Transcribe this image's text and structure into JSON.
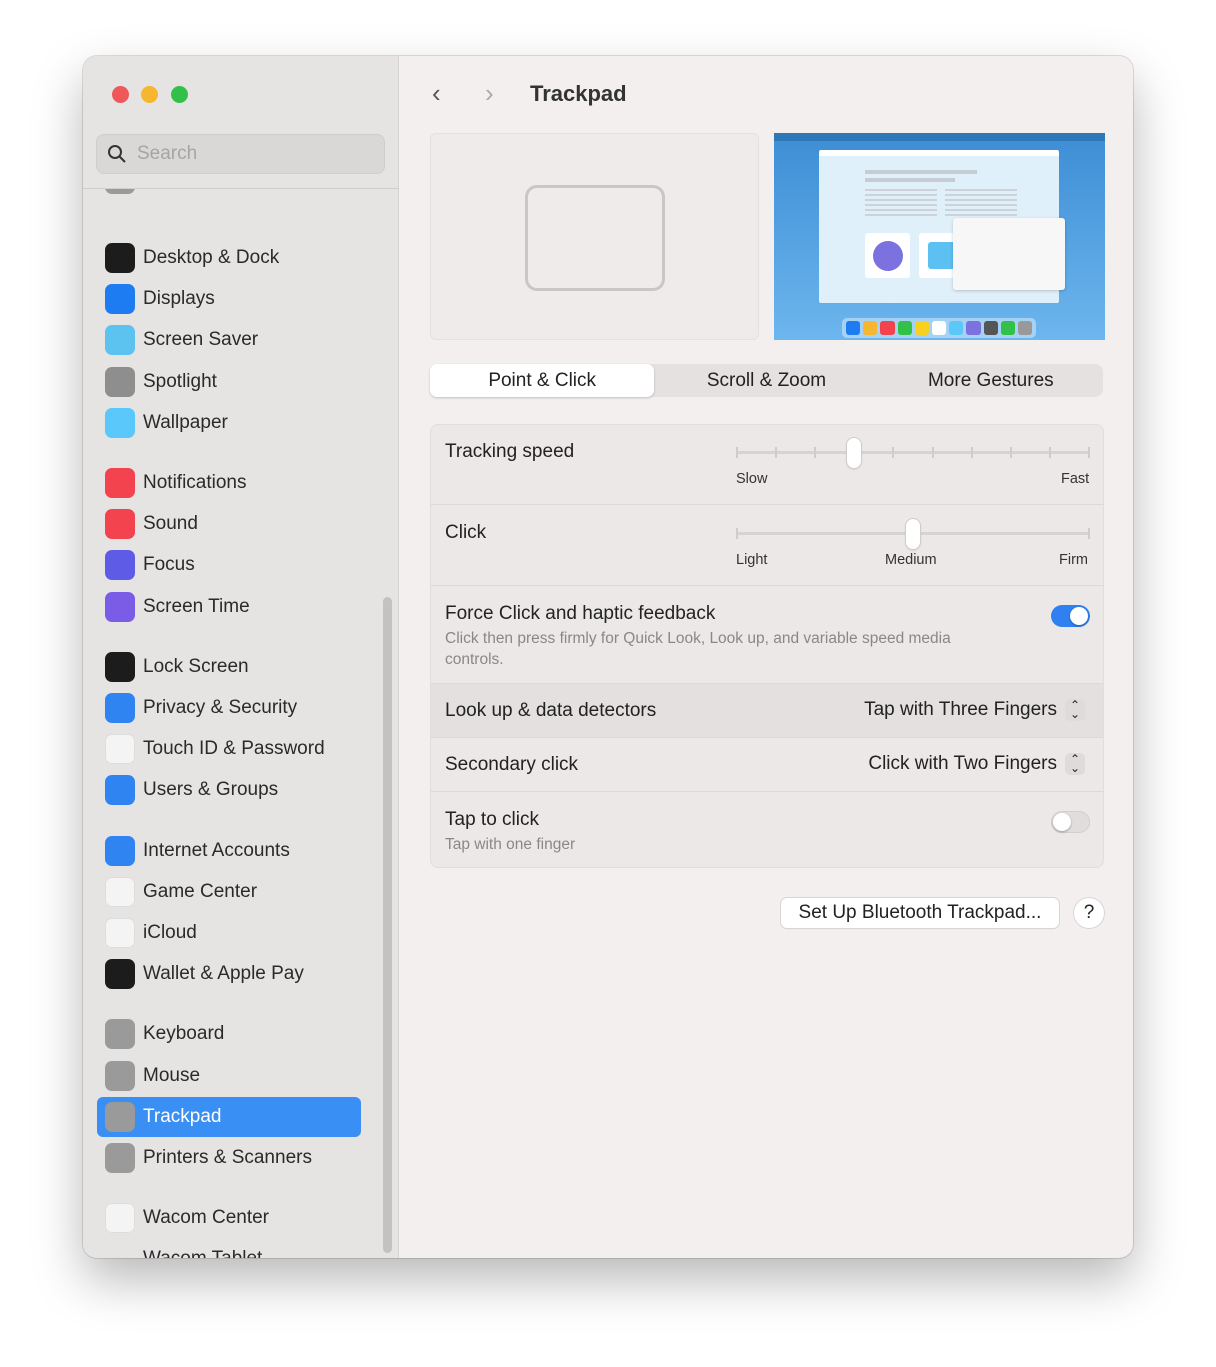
{
  "window": {
    "title": "Trackpad"
  },
  "sidebar": {
    "search_placeholder": "Search",
    "items": [
      {
        "label": "Desktop & Dock",
        "icon": "desktop-dock-icon",
        "color": "#1c1c1c"
      },
      {
        "label": "Displays",
        "icon": "displays-icon",
        "color": "#1e7cf2"
      },
      {
        "label": "Screen Saver",
        "icon": "screen-saver-icon",
        "color": "#5cc3f0"
      },
      {
        "label": "Spotlight",
        "icon": "spotlight-icon",
        "color": "#8e8e8e"
      },
      {
        "label": "Wallpaper",
        "icon": "wallpaper-icon",
        "color": "#5ac8fa"
      },
      {
        "label": "Notifications",
        "icon": "notifications-icon",
        "color": "#f2434f"
      },
      {
        "label": "Sound",
        "icon": "sound-icon",
        "color": "#f2434f"
      },
      {
        "label": "Focus",
        "icon": "focus-icon",
        "color": "#5e5ce6"
      },
      {
        "label": "Screen Time",
        "icon": "screen-time-icon",
        "color": "#7b5ce6"
      },
      {
        "label": "Lock Screen",
        "icon": "lock-screen-icon",
        "color": "#1c1c1c"
      },
      {
        "label": "Privacy & Security",
        "icon": "privacy-hand-icon",
        "color": "#2f84f2"
      },
      {
        "label": "Touch ID & Password",
        "icon": "fingerprint-icon",
        "color": "#f4f4f4"
      },
      {
        "label": "Users & Groups",
        "icon": "users-icon",
        "color": "#2f84f2"
      },
      {
        "label": "Internet Accounts",
        "icon": "at-icon",
        "color": "#2f84f2"
      },
      {
        "label": "Game Center",
        "icon": "game-center-icon",
        "color": "#f4f4f4"
      },
      {
        "label": "iCloud",
        "icon": "icloud-icon",
        "color": "#f4f4f4"
      },
      {
        "label": "Wallet & Apple Pay",
        "icon": "wallet-icon",
        "color": "#1c1c1c"
      },
      {
        "label": "Keyboard",
        "icon": "keyboard-icon",
        "color": "#9a9a9a"
      },
      {
        "label": "Mouse",
        "icon": "mouse-icon",
        "color": "#9a9a9a"
      },
      {
        "label": "Trackpad",
        "icon": "trackpad-icon",
        "color": "#9a9a9a",
        "selected": true
      },
      {
        "label": "Printers & Scanners",
        "icon": "printer-icon",
        "color": "#9a9a9a"
      },
      {
        "label": "Wacom Center",
        "icon": "wacom-center-icon",
        "color": "#f4f4f4"
      },
      {
        "label": "Wacom Tablet",
        "icon": "wacom-tablet-icon",
        "color": "transparent"
      }
    ]
  },
  "tabs": [
    {
      "label": "Point & Click",
      "active": true
    },
    {
      "label": "Scroll & Zoom"
    },
    {
      "label": "More Gestures"
    }
  ],
  "settings": {
    "tracking_speed": {
      "label": "Tracking speed",
      "min_label": "Slow",
      "max_label": "Fast",
      "value_step": 3,
      "steps": 10
    },
    "click": {
      "label": "Click",
      "labels": [
        "Light",
        "Medium",
        "Firm"
      ],
      "value": "Medium"
    },
    "force_click": {
      "label": "Force Click and haptic feedback",
      "description": "Click then press firmly for Quick Look, Look up, and variable speed media controls.",
      "on": true
    },
    "lookup": {
      "label": "Look up & data detectors",
      "value": "Tap with Three Fingers"
    },
    "secondary": {
      "label": "Secondary click",
      "value": "Click with Two Fingers"
    },
    "tap": {
      "label": "Tap to click",
      "description": "Tap with one finger",
      "on": false
    }
  },
  "buttons": {
    "bluetooth": "Set Up Bluetooth Trackpad...",
    "help": "?"
  },
  "colors": {
    "accent": "#3a8ff5",
    "toggle_on": "#2f80f0"
  }
}
